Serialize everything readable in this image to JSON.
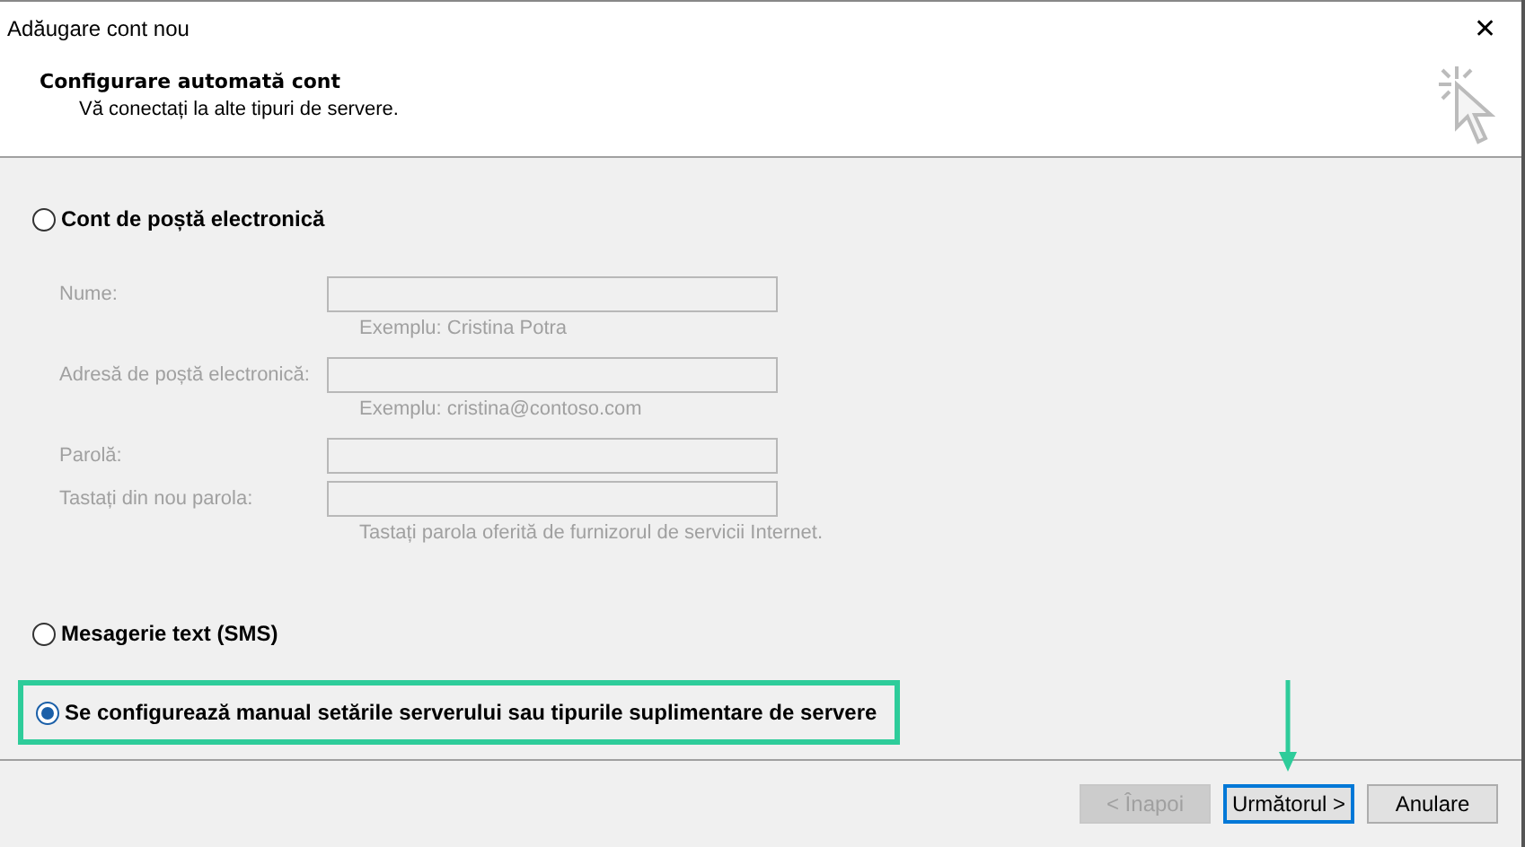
{
  "window": {
    "title": "Adăugare cont nou",
    "close": "✕"
  },
  "header": {
    "title": "Configurare automată cont",
    "subtitle": "Vă conectați la alte tipuri de servere."
  },
  "options": [
    {
      "label": "Cont de poștă electronică",
      "selected": false,
      "highlighted": false,
      "fields": [
        {
          "label": "Nume:",
          "hint": "Exemplu: Cristina Potra",
          "disabled": true
        },
        {
          "label": "Adresă de poștă electronică:",
          "hint": "Exemplu: cristina@contoso.com",
          "disabled": true
        },
        {
          "label": "Parolă:",
          "disabled": true
        },
        {
          "label": "Tastați din nou parola:",
          "hint": "Tastați parola oferită de furnizorul de servicii Internet.",
          "disabled": true
        }
      ]
    },
    {
      "label": "Mesagerie text (SMS)",
      "selected": false,
      "highlighted": false
    },
    {
      "label": "Se configurează manual setările serverului sau tipurile suplimentare de servere",
      "selected": true,
      "highlighted": true
    }
  ],
  "buttons": [
    {
      "label": "< Înapoi",
      "disabled": true,
      "default": false,
      "pointed": false
    },
    {
      "label": "Următorul >",
      "disabled": false,
      "default": true,
      "pointed": true
    },
    {
      "label": "Anulare",
      "disabled": false,
      "default": false,
      "pointed": false
    }
  ]
}
